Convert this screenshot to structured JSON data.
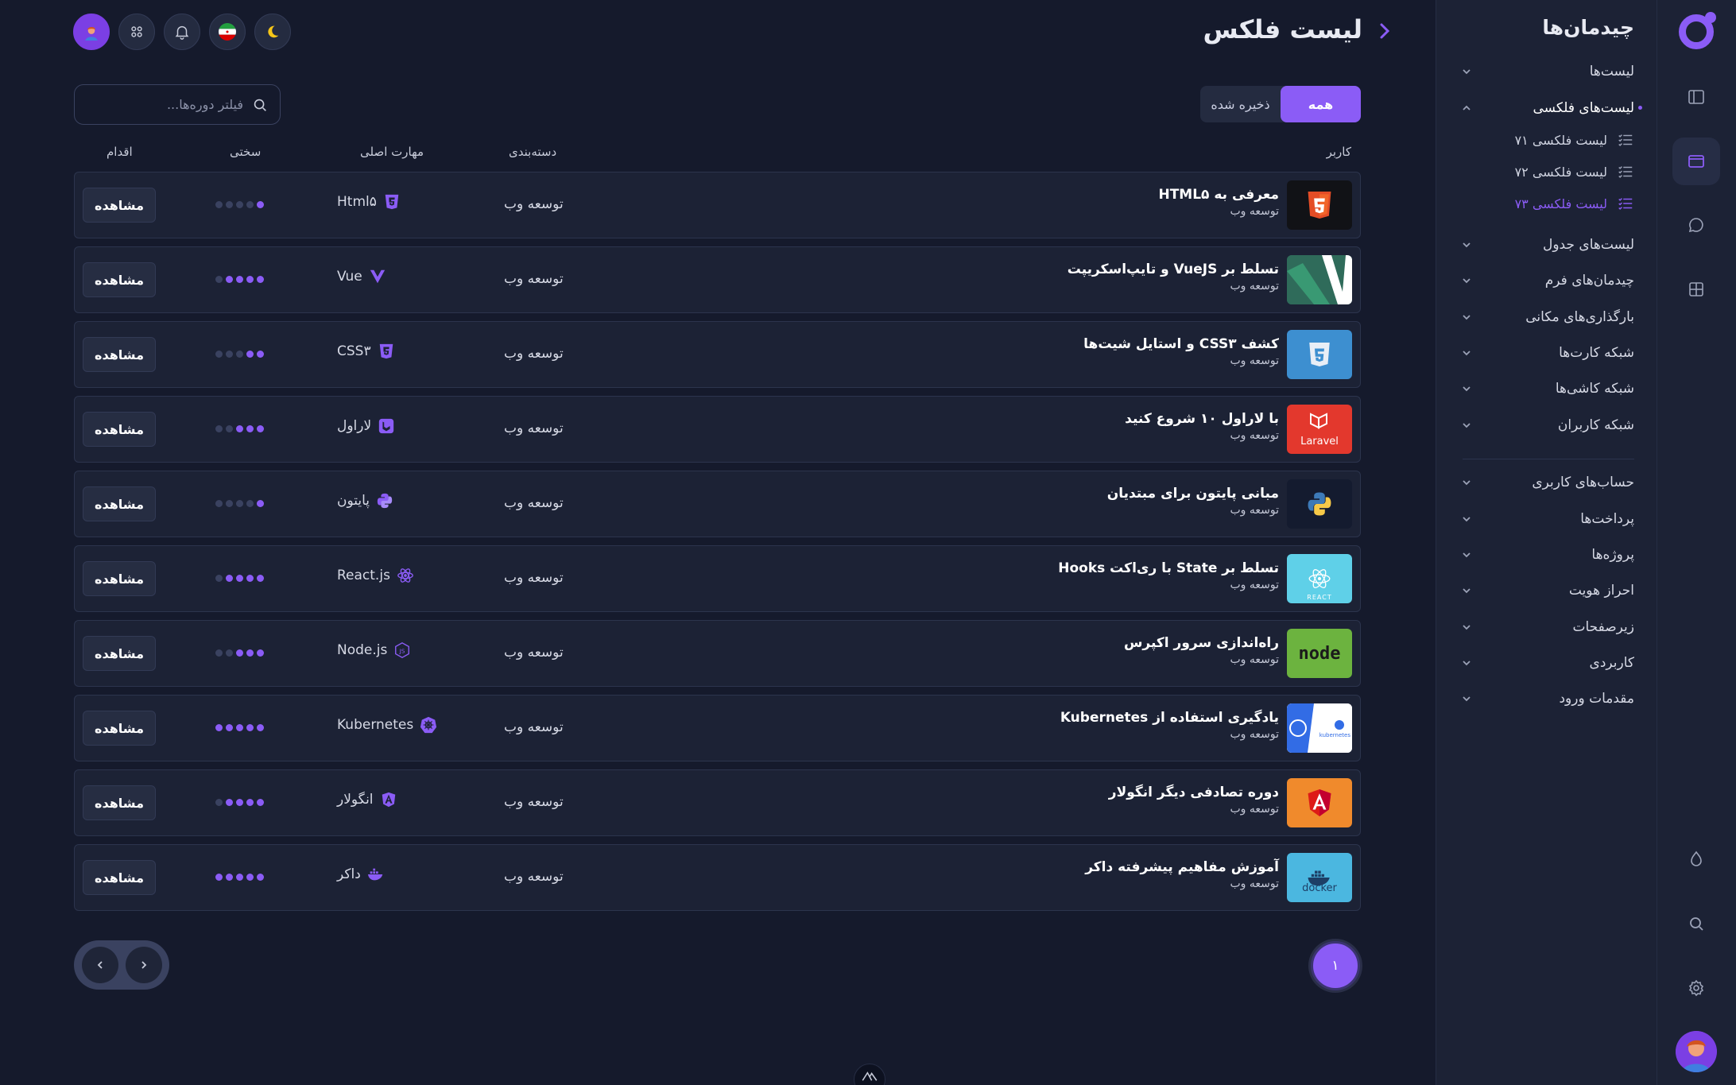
{
  "header": {
    "title": "لیست فلکس",
    "filters": {
      "all": "همه",
      "saved": "ذخیره شده"
    },
    "search_placeholder": "فیلتر دوره‌ها..."
  },
  "columns": {
    "user": "کاربر",
    "category": "دسته‌بندی",
    "skill": "مهارت اصلی",
    "difficulty": "سختی",
    "action": "اقدام"
  },
  "rows": [
    {
      "title": "معرفی به HTML۵",
      "sub": "توسعه وب",
      "category": "توسعه وب",
      "skill": "Html۵",
      "skill_icon": "html5-icon",
      "level": 1,
      "action": "مشاهده",
      "thumb_color": "#111216",
      "thumb_icon": "html5-logo"
    },
    {
      "title": "تسلط بر VueJS و تایپ‌اسکریپت",
      "sub": "توسعه وب",
      "category": "توسعه وب",
      "skill": "Vue",
      "skill_icon": "vue-icon",
      "level": 4,
      "action": "مشاهده",
      "thumb_color": "#2f6b5a",
      "thumb_icon": "vue-logo"
    },
    {
      "title": "کشف CSS۳ و استایل شیت‌ها",
      "sub": "توسعه وب",
      "category": "توسعه وب",
      "skill": "CSS۳",
      "skill_icon": "css3-icon",
      "level": 2,
      "action": "مشاهده",
      "thumb_color": "#3d8fd0",
      "thumb_icon": "css3-logo"
    },
    {
      "title": "با لاراول ۱۰ شروع کنید",
      "sub": "توسعه وب",
      "category": "توسعه وب",
      "skill": "لاراول",
      "skill_icon": "laravel-icon",
      "level": 3,
      "action": "مشاهده",
      "thumb_color": "#e3382d",
      "thumb_icon": "laravel-logo",
      "thumb_text": "Laravel"
    },
    {
      "title": "مبانی پایتون برای مبتدیان",
      "sub": "توسعه وب",
      "category": "توسعه وب",
      "skill": "پایتون",
      "skill_icon": "python-icon",
      "level": 1,
      "action": "مشاهده",
      "thumb_color": "#141b2f",
      "thumb_icon": "python-logo"
    },
    {
      "title": "تسلط بر State با ری‌اکت Hooks",
      "sub": "توسعه وب",
      "category": "توسعه وب",
      "skill": "React.js",
      "skill_icon": "react-icon",
      "level": 4,
      "action": "مشاهده",
      "thumb_color": "#5fd0e8",
      "thumb_icon": "react-logo",
      "thumb_text": "REACT"
    },
    {
      "title": "راه‌اندازی سرور اکپرس",
      "sub": "توسعه وب",
      "category": "توسعه وب",
      "skill": "Node.js",
      "skill_icon": "nodejs-icon",
      "level": 3,
      "action": "مشاهده",
      "thumb_color": "#6cb33f",
      "thumb_icon": "node-logo",
      "thumb_text": "node"
    },
    {
      "title": "یادگیری استفاده از Kubernetes",
      "sub": "توسعه وب",
      "category": "توسعه وب",
      "skill": "Kubernetes",
      "skill_icon": "kubernetes-icon",
      "level": 5,
      "action": "مشاهده",
      "thumb_color": "#ffffff",
      "thumb_icon": "kubernetes-logo",
      "thumb_text": "kubernetes"
    },
    {
      "title": "دوره تصادفی دیگر انگولار",
      "sub": "توسعه وب",
      "category": "توسعه وب",
      "skill": "انگولار",
      "skill_icon": "angular-icon",
      "level": 4,
      "action": "مشاهده",
      "thumb_color": "#f08a2c",
      "thumb_icon": "angular-logo"
    },
    {
      "title": "آموزش مفاهیم پیشرفته داکر",
      "sub": "توسعه وب",
      "category": "توسعه وب",
      "skill": "داکر",
      "skill_icon": "docker-icon",
      "level": 5,
      "action": "مشاهده",
      "thumb_color": "#4bb7e0",
      "thumb_icon": "docker-logo",
      "thumb_text": "docker"
    }
  ],
  "pagination": {
    "current": "۱"
  },
  "sidebar": {
    "title": "چیدمان‌ها",
    "items": [
      {
        "label": "لیست‌ها",
        "open": false
      },
      {
        "label": "لیست‌های فلکسی",
        "open": true
      },
      {
        "label": "لیست‌های جدول",
        "open": false
      },
      {
        "label": "چیدمان‌های فرم",
        "open": false
      },
      {
        "label": "بارگذاری‌های مکانی",
        "open": false
      },
      {
        "label": "شبکه کارت‌ها",
        "open": false
      },
      {
        "label": "شبکه کاشی‌ها",
        "open": false
      },
      {
        "label": "شبکه کاربران",
        "open": false
      },
      {
        "label": "حساب‌های کاربری",
        "open": false
      },
      {
        "label": "پرداخت‌ها",
        "open": false
      },
      {
        "label": "پروژه‌ها",
        "open": false
      },
      {
        "label": "احراز هویت",
        "open": false
      },
      {
        "label": "زیرصفحات",
        "open": false
      },
      {
        "label": "کاربردی",
        "open": false
      },
      {
        "label": "مقدمات ورود",
        "open": false
      }
    ],
    "sub_items": [
      {
        "label": "لیست فلکسی ۷۱",
        "active": false
      },
      {
        "label": "لیست فلکسی ۷۲",
        "active": false
      },
      {
        "label": "لیست فلکسی ۷۳",
        "active": true
      }
    ]
  },
  "colors": {
    "accent": "#8b5cf6",
    "bg": "#151a2c",
    "panel": "#1c2235"
  }
}
